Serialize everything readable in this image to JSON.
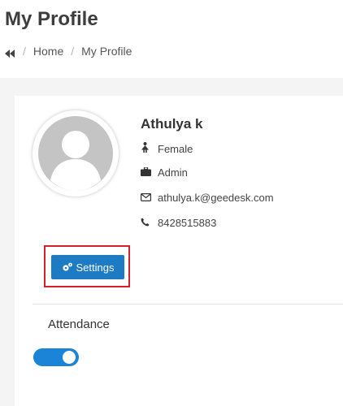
{
  "header": {
    "title": "My Profile",
    "breadcrumb": {
      "back_icon": "double-chevron-left-icon",
      "items": [
        "Home",
        "My Profile"
      ],
      "separator": "/"
    }
  },
  "profile": {
    "name": "Athulya k",
    "avatar_icon": "default-user-avatar",
    "gender": {
      "icon": "female-icon",
      "value": "Female"
    },
    "role": {
      "icon": "briefcase-icon",
      "value": "Admin"
    },
    "email": {
      "icon": "envelope-icon",
      "value": "athulya.k@geedesk.com"
    },
    "phone": {
      "icon": "phone-icon",
      "value": "8428515883"
    }
  },
  "settings_button": {
    "icon": "gears-icon",
    "label": "Settings"
  },
  "attendance": {
    "label": "Attendance",
    "toggle_on": true
  },
  "colors": {
    "primary": "#1c7bc2",
    "toggle": "#1c84d6",
    "highlight": "#d4202f",
    "background": "#f4f4f4"
  }
}
